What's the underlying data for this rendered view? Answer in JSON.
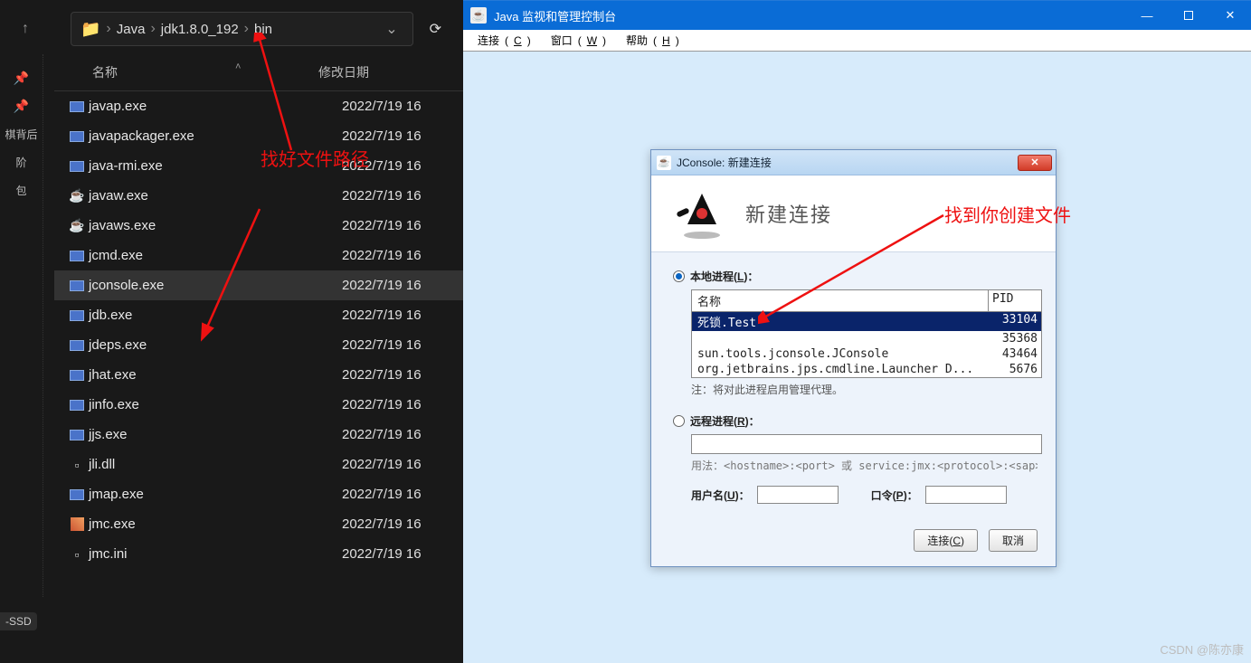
{
  "explorer": {
    "breadcrumb": [
      "Java",
      "jdk1.8.0_192",
      "bin"
    ],
    "columns": {
      "name": "名称",
      "date": "修改日期"
    },
    "pinned": [
      "棋背后",
      "阶",
      "-SSD"
    ],
    "selected_index": 6,
    "files": [
      {
        "name": "javap.exe",
        "date": "2022/7/19 16",
        "icon": "exe"
      },
      {
        "name": "javapackager.exe",
        "date": "2022/7/19 16",
        "icon": "exe"
      },
      {
        "name": "java-rmi.exe",
        "date": "2022/7/19 16",
        "icon": "exe"
      },
      {
        "name": "javaw.exe",
        "date": "2022/7/19 16",
        "icon": "java"
      },
      {
        "name": "javaws.exe",
        "date": "2022/7/19 16",
        "icon": "java"
      },
      {
        "name": "jcmd.exe",
        "date": "2022/7/19 16",
        "icon": "exe"
      },
      {
        "name": "jconsole.exe",
        "date": "2022/7/19 16",
        "icon": "exe"
      },
      {
        "name": "jdb.exe",
        "date": "2022/7/19 16",
        "icon": "exe"
      },
      {
        "name": "jdeps.exe",
        "date": "2022/7/19 16",
        "icon": "exe"
      },
      {
        "name": "jhat.exe",
        "date": "2022/7/19 16",
        "icon": "exe"
      },
      {
        "name": "jinfo.exe",
        "date": "2022/7/19 16",
        "icon": "exe"
      },
      {
        "name": "jjs.exe",
        "date": "2022/7/19 16",
        "icon": "exe"
      },
      {
        "name": "jli.dll",
        "date": "2022/7/19 16",
        "icon": "dll"
      },
      {
        "name": "jmap.exe",
        "date": "2022/7/19 16",
        "icon": "exe"
      },
      {
        "name": "jmc.exe",
        "date": "2022/7/19 16",
        "icon": "jmc"
      },
      {
        "name": "jmc.ini",
        "date": "2022/7/19 16",
        "icon": "dll"
      }
    ]
  },
  "jconsole": {
    "window_title": "Java 监视和管理控制台",
    "menus": {
      "connect": "连接",
      "c_key": "C",
      "window": "窗口",
      "w_key": "W",
      "help": "帮助",
      "h_key": "H"
    },
    "dialog": {
      "title": "JConsole: 新建连接",
      "header": "新建连接",
      "local_label_a": "本地进程(",
      "local_key": "L",
      "local_label_b": ")：",
      "table": {
        "name": "名称",
        "pid": "PID"
      },
      "processes": [
        {
          "name": "死锁.Test",
          "pid": "33104",
          "selected": true
        },
        {
          "name": "",
          "pid": "35368"
        },
        {
          "name": "sun.tools.jconsole.JConsole",
          "pid": "43464"
        },
        {
          "name": "org.jetbrains.jps.cmdline.Launcher D...",
          "pid": "5676"
        }
      ],
      "note": "注：将对此进程启用管理代理。",
      "remote_label_a": "远程进程(",
      "remote_key": "R",
      "remote_label_b": ")：",
      "usage": "用法：<hostname>:<port> 或 service:jmx:<protocol>:<sap>",
      "user_a": "用户名(",
      "user_key": "U",
      "user_b": ")：",
      "pass_a": "口令(",
      "pass_key": "P",
      "pass_b": ")：",
      "connect_a": "连接(",
      "connect_key": "C",
      "connect_b": ")",
      "cancel": "取消"
    }
  },
  "annotations": {
    "path": "找好文件路径",
    "process": "找到你创建文件"
  },
  "watermark": "CSDN @陈亦康"
}
